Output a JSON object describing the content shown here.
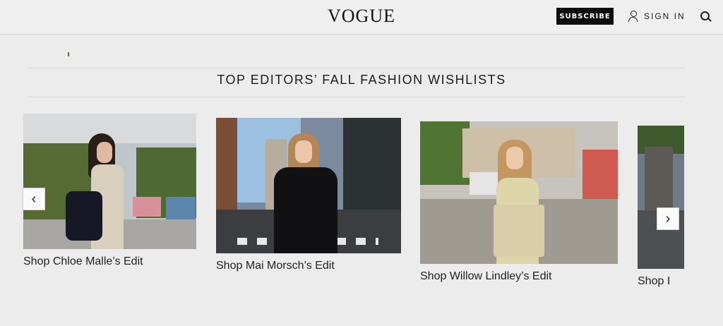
{
  "header": {
    "logo": "VOGUE",
    "subscribe_label": "SUBSCRIBE",
    "signin_label": "SIGN IN",
    "icons": [
      "user-icon",
      "search-icon"
    ]
  },
  "section": {
    "title": "TOP EDITORS’ FALL FASHION WISHLISTS"
  },
  "carousel": {
    "items": [
      {
        "caption": "Shop Chloe Malle’s Edit"
      },
      {
        "caption": "Shop Mai Morsch’s Edit"
      },
      {
        "caption": "Shop Willow Lindley’s Edit"
      },
      {
        "caption": "Shop I"
      }
    ],
    "prev_icon": "chevron-left-icon",
    "next_icon": "chevron-right-icon"
  },
  "colors": {
    "header_bg": "#efefef",
    "subscribe_bg": "#0d0d0d",
    "page_bg": "#ececec"
  }
}
